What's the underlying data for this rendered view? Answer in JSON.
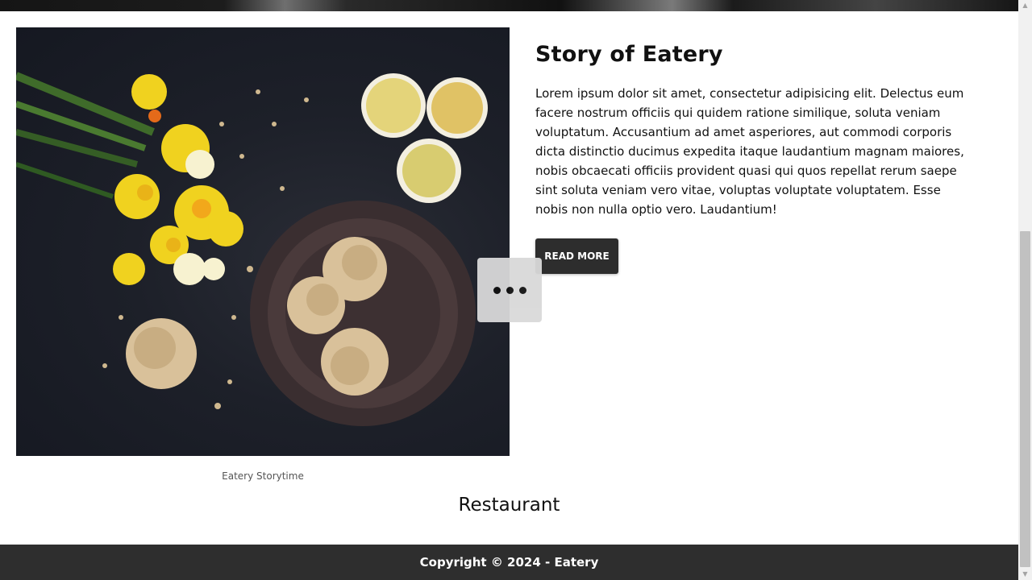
{
  "story": {
    "title": "Story of Eatery",
    "body": "Lorem ipsum dolor sit amet, consectetur adipisicing elit. Delectus eum facere nostrum officiis qui quidem ratione similique, soluta veniam voluptatum. Accusantium ad amet asperiores, aut commodi corporis dicta distinctio ducimus expedita itaque laudantium magnam maiores, nobis obcaecati officiis provident quasi qui quos repellat rerum saepe sint soluta veniam vero vitae, voluptas voluptate voluptatem. Esse nobis non nulla optio vero. Laudantium!",
    "button_label": "READ MORE"
  },
  "image": {
    "caption": "Eatery Storytime",
    "alt": "Eatery Storytime"
  },
  "section": {
    "heading": "Restaurant"
  },
  "footer": {
    "copyright": "Copyright © 2024 - Eatery"
  },
  "icons": {
    "loader": "loading-dots-icon",
    "scroll_up": "triangle-up-icon",
    "scroll_down": "triangle-down-icon"
  },
  "colors": {
    "button_bg": "#2d2d2d",
    "footer_bg": "#2e2e2e",
    "loader_bg": "#d9d9d9"
  }
}
